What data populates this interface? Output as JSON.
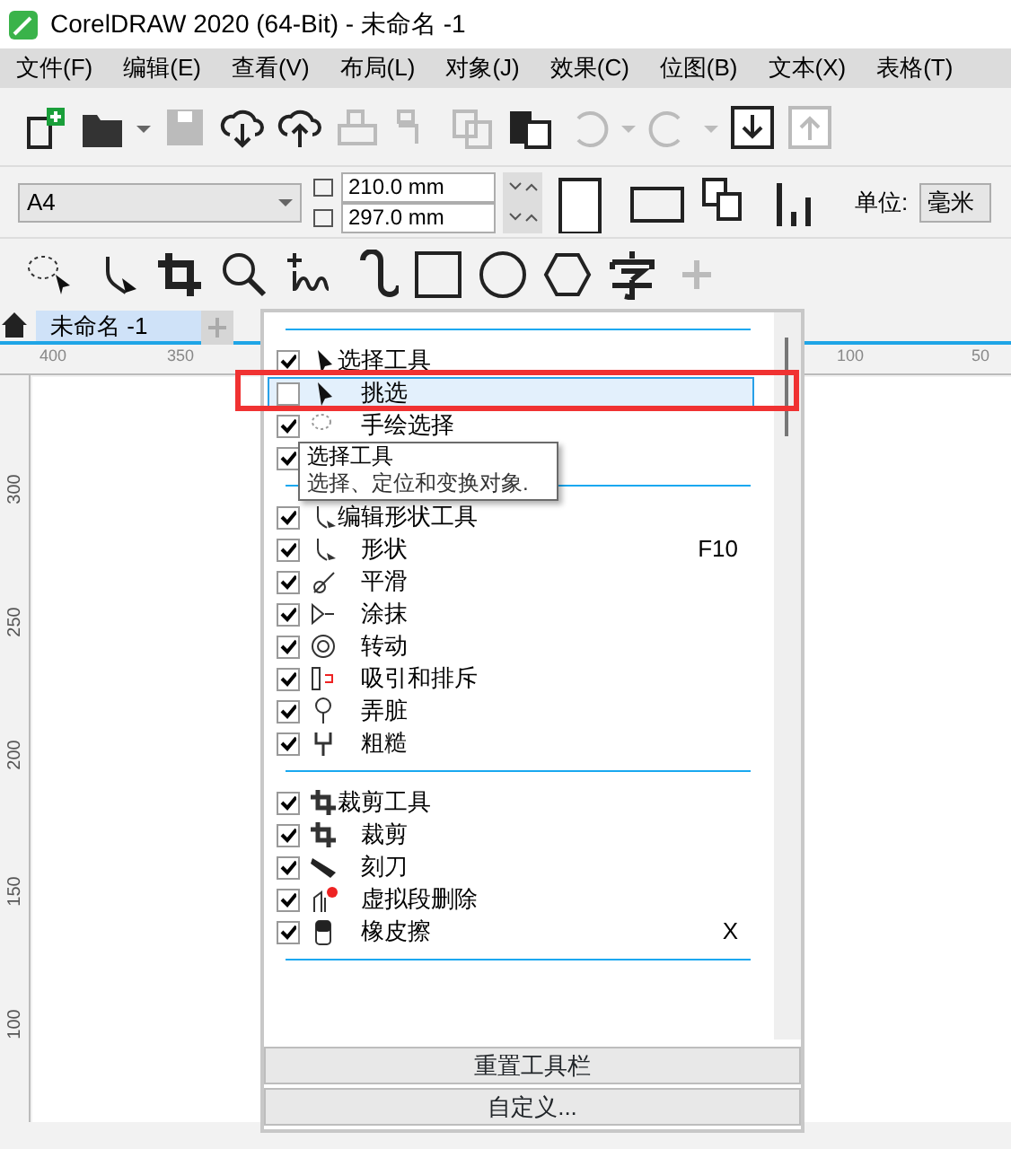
{
  "window": {
    "title": "CorelDRAW 2020 (64-Bit) - 未命名 -1"
  },
  "menu_bar": [
    "文件(F)",
    "编辑(E)",
    "查看(V)",
    "布局(L)",
    "对象(J)",
    "效果(C)",
    "位图(B)",
    "文本(X)",
    "表格(T)"
  ],
  "property_bar": {
    "page_size": "A4",
    "width": "210.0 mm",
    "height": "297.0 mm",
    "units_label": "单位:",
    "units": "毫米"
  },
  "tabs": [
    {
      "label": "未命名 -1",
      "selected": true
    }
  ],
  "top_ruler": [
    "400",
    "350",
    "100",
    "50"
  ],
  "left_ruler": [
    "300",
    "250",
    "200",
    "150",
    "100"
  ],
  "popup": {
    "groups": [
      {
        "items": [
          {
            "label": "选择工具",
            "kind": "group",
            "checked": true,
            "selected": false
          },
          {
            "label": "挑选",
            "kind": "tool",
            "checked": false,
            "selected": true
          },
          {
            "label": "手绘选择",
            "kind": "tool",
            "checked": true,
            "selected": false
          },
          {
            "kind": "tool",
            "checked": true,
            "selected": false
          }
        ]
      },
      {
        "items": [
          {
            "label": "编辑形状工具",
            "kind": "group",
            "checked": true,
            "selected": false
          },
          {
            "label": "形状",
            "kind": "tool",
            "checked": true,
            "selected": false,
            "shortcut": "F10"
          },
          {
            "label": "平滑",
            "kind": "tool",
            "checked": true,
            "selected": false
          },
          {
            "label": "涂抹",
            "kind": "tool",
            "checked": true,
            "selected": false
          },
          {
            "label": "转动",
            "kind": "tool",
            "checked": true,
            "selected": false
          },
          {
            "label": "吸引和排斥",
            "kind": "tool",
            "checked": true,
            "selected": false
          },
          {
            "label": "弄脏",
            "kind": "tool",
            "checked": true,
            "selected": false
          },
          {
            "label": "粗糙",
            "kind": "tool",
            "checked": true,
            "selected": false
          }
        ]
      },
      {
        "items": [
          {
            "label": "裁剪工具",
            "kind": "group",
            "checked": true,
            "selected": false
          },
          {
            "label": "裁剪",
            "kind": "tool",
            "checked": true,
            "selected": false
          },
          {
            "label": "刻刀",
            "kind": "tool",
            "checked": true,
            "selected": false
          },
          {
            "label": "虚拟段删除",
            "kind": "tool",
            "checked": true,
            "selected": false
          },
          {
            "label": "橡皮擦",
            "kind": "tool",
            "checked": true,
            "selected": false,
            "shortcut": "X"
          }
        ]
      }
    ],
    "buttons": [
      "重置工具栏",
      "自定义..."
    ],
    "tooltip": {
      "title": "选择工具",
      "text": "选择、定位和变换对象."
    }
  }
}
